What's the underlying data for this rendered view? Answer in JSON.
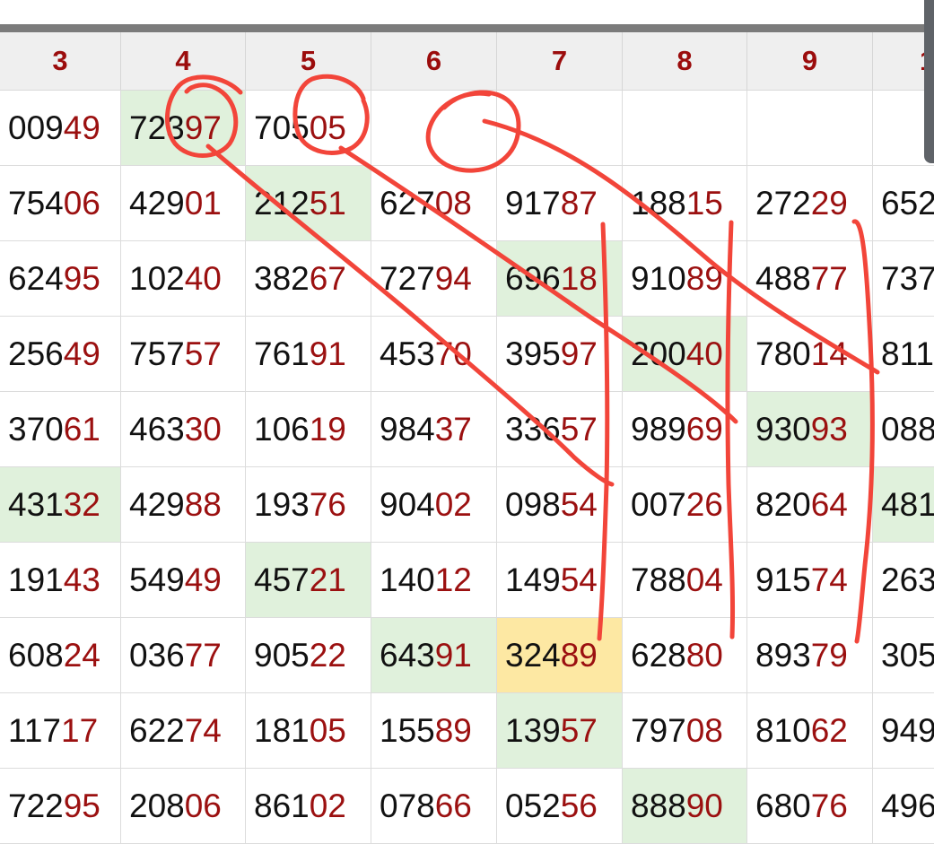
{
  "columns": [
    "3",
    "4",
    "5",
    "6",
    "7",
    "8",
    "9",
    "1"
  ],
  "rows": [
    [
      {
        "head": "009",
        "tail": "49"
      },
      {
        "head": "723",
        "tail": "97",
        "bg": "green"
      },
      {
        "head": "705",
        "tail": "05"
      },
      {
        "head": "",
        "tail": ""
      },
      {
        "head": "",
        "tail": ""
      },
      {
        "head": "",
        "tail": ""
      },
      {
        "head": "",
        "tail": ""
      },
      {
        "head": "",
        "tail": ""
      }
    ],
    [
      {
        "head": "754",
        "tail": "06"
      },
      {
        "head": "429",
        "tail": "01"
      },
      {
        "head": "212",
        "tail": "51",
        "bg": "green"
      },
      {
        "head": "627",
        "tail": "08"
      },
      {
        "head": "917",
        "tail": "87"
      },
      {
        "head": "188",
        "tail": "15"
      },
      {
        "head": "272",
        "tail": "29"
      },
      {
        "head": "652",
        "tail": ""
      }
    ],
    [
      {
        "head": "624",
        "tail": "95"
      },
      {
        "head": "102",
        "tail": "40"
      },
      {
        "head": "382",
        "tail": "67"
      },
      {
        "head": "727",
        "tail": "94"
      },
      {
        "head": "696",
        "tail": "18",
        "bg": "green"
      },
      {
        "head": "910",
        "tail": "89"
      },
      {
        "head": "488",
        "tail": "77"
      },
      {
        "head": "737",
        "tail": ""
      }
    ],
    [
      {
        "head": "256",
        "tail": "49"
      },
      {
        "head": "757",
        "tail": "57"
      },
      {
        "head": "761",
        "tail": "91"
      },
      {
        "head": "453",
        "tail": "70"
      },
      {
        "head": "395",
        "tail": "97"
      },
      {
        "head": "200",
        "tail": "40",
        "bg": "green"
      },
      {
        "head": "780",
        "tail": "14"
      },
      {
        "head": "811",
        "tail": ""
      }
    ],
    [
      {
        "head": "370",
        "tail": "61"
      },
      {
        "head": "463",
        "tail": "30"
      },
      {
        "head": "106",
        "tail": "19"
      },
      {
        "head": "984",
        "tail": "37"
      },
      {
        "head": "336",
        "tail": "57"
      },
      {
        "head": "989",
        "tail": "69"
      },
      {
        "head": "930",
        "tail": "93",
        "bg": "green"
      },
      {
        "head": "088",
        "tail": ""
      }
    ],
    [
      {
        "head": "431",
        "tail": "32",
        "bg": "green"
      },
      {
        "head": "429",
        "tail": "88"
      },
      {
        "head": "193",
        "tail": "76"
      },
      {
        "head": "904",
        "tail": "02"
      },
      {
        "head": "098",
        "tail": "54"
      },
      {
        "head": "007",
        "tail": "26"
      },
      {
        "head": "820",
        "tail": "64"
      },
      {
        "head": "481",
        "tail": "",
        "bg": "green"
      }
    ],
    [
      {
        "head": "191",
        "tail": "43"
      },
      {
        "head": "549",
        "tail": "49"
      },
      {
        "head": "457",
        "tail": "21",
        "bg": "green"
      },
      {
        "head": "140",
        "tail": "12"
      },
      {
        "head": "149",
        "tail": "54"
      },
      {
        "head": "788",
        "tail": "04"
      },
      {
        "head": "915",
        "tail": "74"
      },
      {
        "head": "263",
        "tail": ""
      }
    ],
    [
      {
        "head": "608",
        "tail": "24"
      },
      {
        "head": "036",
        "tail": "77"
      },
      {
        "head": "905",
        "tail": "22"
      },
      {
        "head": "643",
        "tail": "91",
        "bg": "green"
      },
      {
        "head": "324",
        "tail": "89",
        "bg": "yellow"
      },
      {
        "head": "628",
        "tail": "80"
      },
      {
        "head": "893",
        "tail": "79"
      },
      {
        "head": "305",
        "tail": ""
      }
    ],
    [
      {
        "head": "117",
        "tail": "17"
      },
      {
        "head": "622",
        "tail": "74"
      },
      {
        "head": "181",
        "tail": "05"
      },
      {
        "head": "155",
        "tail": "89"
      },
      {
        "head": "139",
        "tail": "57",
        "bg": "green"
      },
      {
        "head": "797",
        "tail": "08"
      },
      {
        "head": "810",
        "tail": "62"
      },
      {
        "head": "949",
        "tail": ""
      }
    ],
    [
      {
        "head": "722",
        "tail": "95"
      },
      {
        "head": "208",
        "tail": "06"
      },
      {
        "head": "861",
        "tail": "02"
      },
      {
        "head": "078",
        "tail": "66"
      },
      {
        "head": "052",
        "tail": "56"
      },
      {
        "head": "888",
        "tail": "90",
        "bg": "green"
      },
      {
        "head": "680",
        "tail": "76"
      },
      {
        "head": "496",
        "tail": ""
      }
    ]
  ],
  "colors": {
    "header_text": "#9b0c0c",
    "tail_text": "#9b1010",
    "highlight_green": "#e0f1dc",
    "highlight_yellow": "#fde8a3",
    "annotation_ink": "#f2453a"
  }
}
